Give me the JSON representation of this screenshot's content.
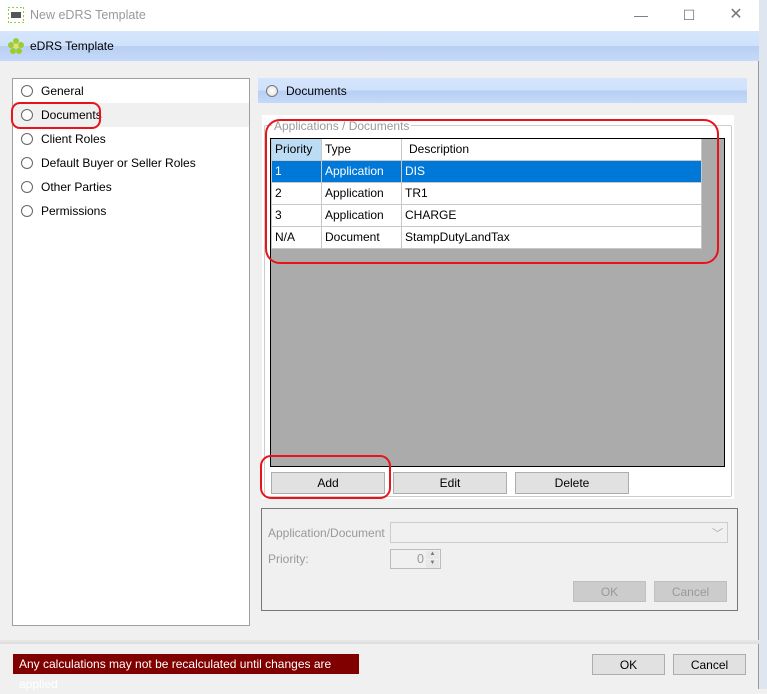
{
  "window": {
    "title": "New eDRS Template",
    "app_icon": "pm-app-icon",
    "controls": [
      "minimize",
      "maximize",
      "close"
    ]
  },
  "header": {
    "title": "eDRS Template",
    "icon": "green-flower-icon"
  },
  "nav": {
    "items": [
      {
        "label": "General",
        "selected": false
      },
      {
        "label": "Documents",
        "selected": true
      },
      {
        "label": "Client Roles",
        "selected": false
      },
      {
        "label": "Default Buyer or Seller Roles",
        "selected": false
      },
      {
        "label": "Other Parties",
        "selected": false
      },
      {
        "label": "Permissions",
        "selected": false
      }
    ]
  },
  "section": {
    "title": "Documents"
  },
  "documents": {
    "group_label": "Applications / Documents",
    "columns": [
      "Priority",
      "Type",
      "Description"
    ],
    "rows": [
      {
        "priority": "1",
        "type": "Application",
        "description": "DIS",
        "selected": true
      },
      {
        "priority": "2",
        "type": "Application",
        "description": "TR1",
        "selected": false
      },
      {
        "priority": "3",
        "type": "Application",
        "description": "CHARGE",
        "selected": false
      },
      {
        "priority": "N/A",
        "type": "Document",
        "description": "StampDutyLandTax",
        "selected": false
      }
    ],
    "buttons": {
      "add": "Add",
      "edit": "Edit",
      "delete": "Delete"
    }
  },
  "editor": {
    "app_doc_label": "Application/Document",
    "app_doc_value": "",
    "priority_label": "Priority:",
    "priority_value": "0",
    "ok": "OK",
    "cancel": "Cancel"
  },
  "footer": {
    "warning": "Any calculations may not be recalculated until changes are applied",
    "warning_color": "#800000",
    "ok": "OK",
    "cancel": "Cancel"
  },
  "colors": {
    "selection": "#0078d7",
    "annotation": "#e8141c"
  }
}
